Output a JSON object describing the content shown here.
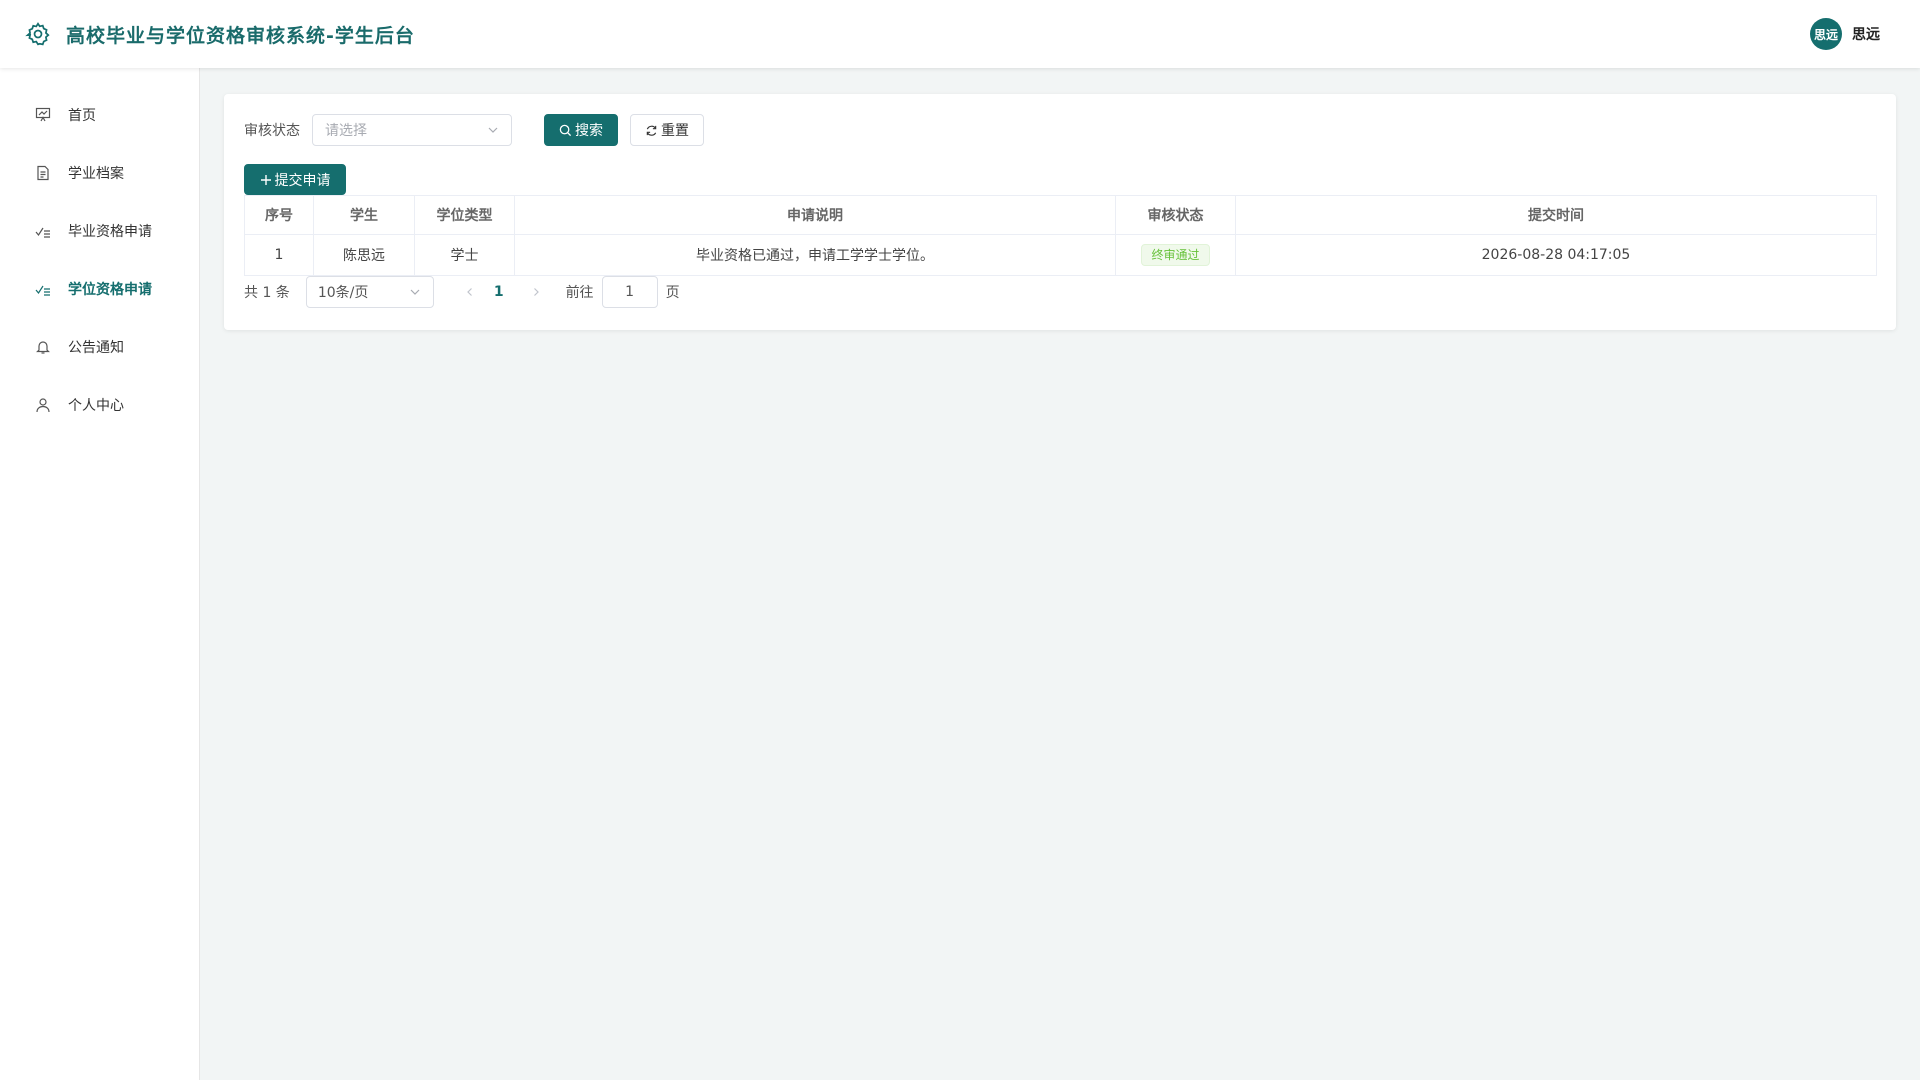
{
  "header": {
    "title": "高校毕业与学位资格审核系统-学生后台",
    "logo_icon": "gear-icon",
    "user": {
      "avatar_text": "思远",
      "name": "思远"
    }
  },
  "sidebar": {
    "items": [
      {
        "label": "首页",
        "icon": "presentation-icon",
        "active": false
      },
      {
        "label": "学业档案",
        "icon": "document-icon",
        "active": false
      },
      {
        "label": "毕业资格申请",
        "icon": "checklist-icon",
        "active": false
      },
      {
        "label": "学位资格申请",
        "icon": "checklist-icon",
        "active": true
      },
      {
        "label": "公告通知",
        "icon": "bell-icon",
        "active": false
      },
      {
        "label": "个人中心",
        "icon": "user-icon",
        "active": false
      }
    ]
  },
  "filters": {
    "status_label": "审核状态",
    "status_placeholder": "请选择",
    "search_label": "搜索",
    "reset_label": "重置"
  },
  "toolbar": {
    "add_label": "提交申请"
  },
  "table": {
    "columns": [
      "序号",
      "学生",
      "学位类型",
      "申请说明",
      "审核状态",
      "提交时间"
    ],
    "rows": [
      {
        "index": "1",
        "student": "陈思远",
        "degree_type": "学士",
        "description": "毕业资格已通过，申请工学学士学位。",
        "status": "终审通过",
        "submitted_at": "2026-08-28 04:17:05"
      }
    ]
  },
  "pagination": {
    "total_text": "共 1 条",
    "page_size": "10条/页",
    "current_page": "1",
    "goto_label": "前往",
    "goto_value": "1",
    "goto_suffix": "页"
  },
  "colors": {
    "primary": "#156e6e",
    "success": "#67c23a",
    "background": "#f2f5f5"
  }
}
